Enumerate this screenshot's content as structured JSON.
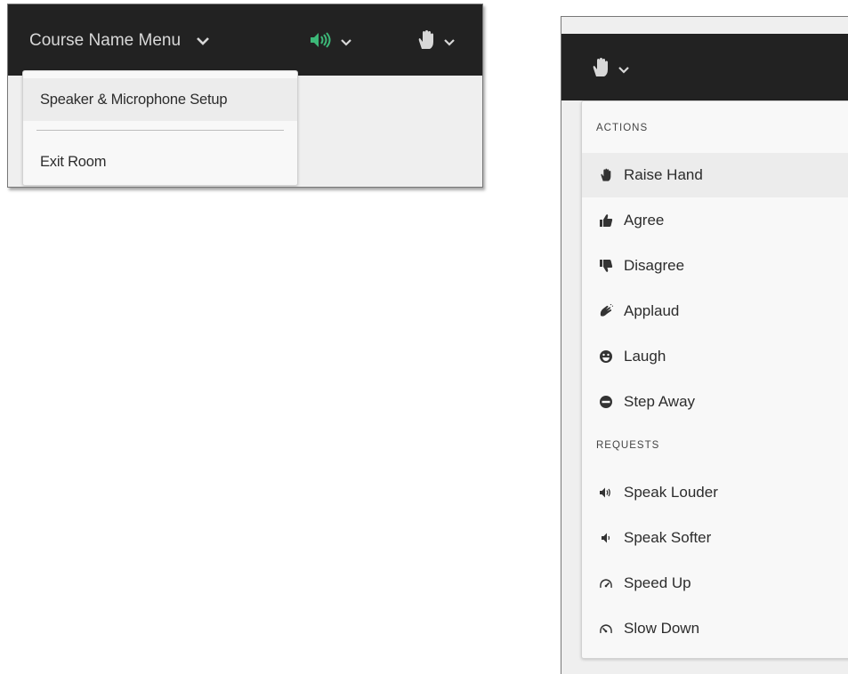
{
  "left": {
    "course_menu_label": "Course Name Menu",
    "menu": {
      "speaker_setup": "Speaker & Microphone Setup",
      "exit_room": "Exit Room"
    }
  },
  "right": {
    "sections": [
      {
        "title": "ACTIONS",
        "items": [
          {
            "label": "Raise Hand",
            "icon": "raise-hand-icon"
          },
          {
            "label": "Agree",
            "icon": "thumbs-up-icon"
          },
          {
            "label": "Disagree",
            "icon": "thumbs-down-icon"
          },
          {
            "label": "Applaud",
            "icon": "applaud-icon"
          },
          {
            "label": "Laugh",
            "icon": "laugh-icon"
          },
          {
            "label": "Step Away",
            "icon": "step-away-icon"
          }
        ]
      },
      {
        "title": "REQUESTS",
        "items": [
          {
            "label": "Speak Louder",
            "icon": "volume-up-icon"
          },
          {
            "label": "Speak Softer",
            "icon": "volume-down-icon"
          },
          {
            "label": "Speed Up",
            "icon": "speed-up-icon"
          },
          {
            "label": "Slow Down",
            "icon": "slow-down-icon"
          }
        ]
      }
    ]
  },
  "colors": {
    "topbar": "#222222",
    "audio_active": "#3cb878",
    "icon_light": "#d8d8d8"
  }
}
